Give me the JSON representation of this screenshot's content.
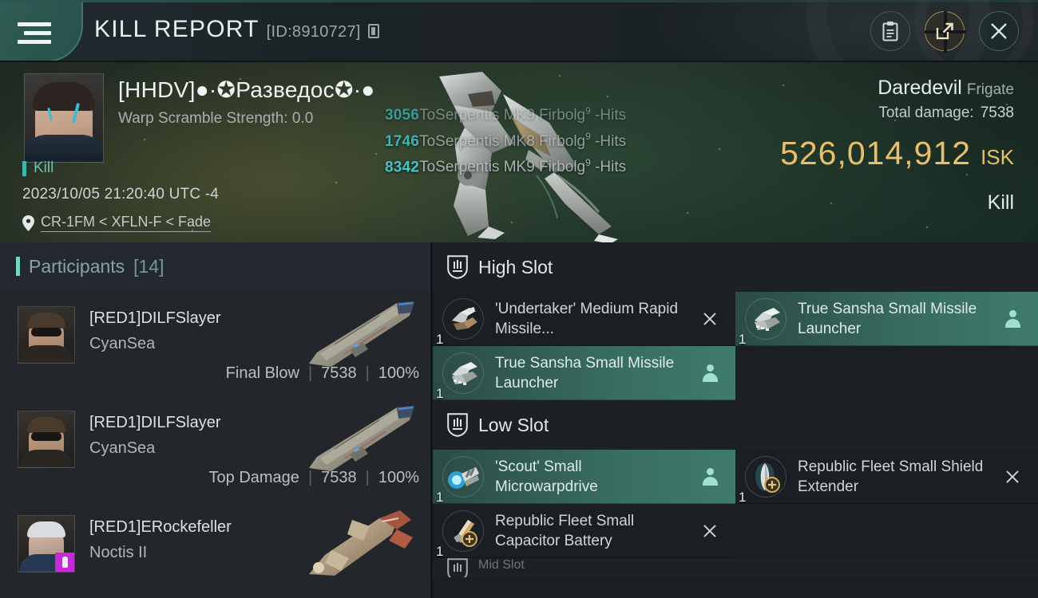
{
  "header": {
    "title": "KILL REPORT",
    "report_id": "[ID:8910727]",
    "menu_icon": "hamburger-menu-icon",
    "copy_icon": "copy-icon",
    "clipboard_icon": "clipboard-icon",
    "share_icon": "external-link-icon",
    "close_icon": "close-icon"
  },
  "victim": {
    "name": "[HHDV]●·✪Разведос✪·●",
    "warp_scramble": "Warp Scramble Strength: 0.0",
    "kill_label": "Kill",
    "timestamp": "2023/10/05 21:20:40 UTC -4",
    "location": "CR-1FM < XFLN-F < Fade",
    "location_icon": "map-pin-icon",
    "ship_name": "Daredevil",
    "ship_class": "Frigate",
    "total_damage_label": "Total damage:",
    "total_damage_value": "7538",
    "isk_value": "526,014,912",
    "isk_unit": "ISK",
    "result": "Kill"
  },
  "hits": [
    {
      "value": "3056",
      "text": "ToSerpentis MK9 Firbolg",
      "sup": "9",
      "suffix": " -Hits"
    },
    {
      "value": "1746",
      "text": "ToSerpentis MK8 Firbolg",
      "sup": "9",
      "suffix": " -Hits"
    },
    {
      "value": "8342",
      "text": "ToSerpentis MK9 Firbolg",
      "sup": "9",
      "suffix": " -Hits"
    }
  ],
  "participants": {
    "title": "Participants",
    "count": "[14]",
    "rows": [
      {
        "name": "[RED1]DILFSlayer",
        "ship": "CyanSea",
        "tag": "Final Blow",
        "damage": "7538",
        "percent": "100%",
        "has_badge": false,
        "skin": "sunglasses"
      },
      {
        "name": "[RED1]DILFSlayer",
        "ship": "CyanSea",
        "tag": "Top Damage",
        "damage": "7538",
        "percent": "100%",
        "has_badge": false,
        "skin": "sunglasses"
      },
      {
        "name": "[RED1]ERockefeller",
        "ship": "Noctis II",
        "tag": "",
        "damage": "",
        "percent": "",
        "has_badge": true,
        "skin": "whitehair"
      }
    ]
  },
  "slots": [
    {
      "title": "High Slot",
      "icon": "slot-shield-icon",
      "modules": [
        {
          "name": "'Undertaker' Medium Rapid Missile...",
          "qty": "1",
          "state": "destroyed",
          "icon": "missile-launcher-icon"
        },
        {
          "name": "True Sansha Small Missile Launcher",
          "qty": "1",
          "state": "dropped",
          "icon": "missile-launcher-icon"
        },
        {
          "name": "True Sansha Small Missile Launcher",
          "qty": "1",
          "state": "dropped",
          "icon": "missile-launcher-icon"
        }
      ]
    },
    {
      "title": "Low Slot",
      "icon": "slot-shield-icon",
      "modules": [
        {
          "name": "'Scout' Small Microwarpdrive",
          "qty": "1",
          "state": "dropped",
          "icon": "microwarpdrive-icon"
        },
        {
          "name": "Republic Fleet Small Shield Extender",
          "qty": "1",
          "state": "destroyed",
          "icon": "shield-extender-icon"
        },
        {
          "name": "Republic Fleet Small Capacitor Battery",
          "qty": "1",
          "state": "destroyed",
          "icon": "capacitor-battery-icon"
        }
      ]
    },
    {
      "title": "Mid Slot",
      "icon": "slot-shield-icon",
      "modules": []
    }
  ],
  "colors": {
    "accent_teal": "#3fb6ab",
    "dropped_teal": "#3f7b6c",
    "isk_gold": "#e8c06a",
    "hit_cyan": "#3fc8cf",
    "badge_purple": "#c42ad8"
  }
}
